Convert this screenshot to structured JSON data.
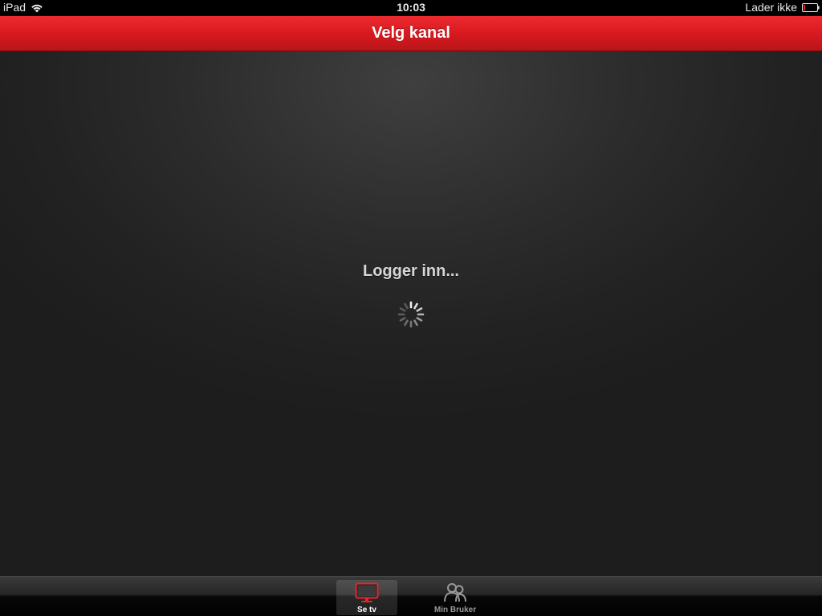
{
  "status_bar": {
    "device": "iPad",
    "time": "10:03",
    "battery_text": "Lader ikke"
  },
  "nav_bar": {
    "title": "Velg kanal"
  },
  "main": {
    "loading_label": "Logger inn...",
    "spinner_icon": "activity-spinner-icon"
  },
  "tab_bar": {
    "tabs": [
      {
        "label": "Se tv",
        "icon": "tv-icon",
        "selected": true
      },
      {
        "label": "Min Bruker",
        "icon": "users-icon",
        "selected": false
      }
    ]
  },
  "colors": {
    "nav_red": "#d81a20",
    "selected_tab_icon": "#e3262c",
    "unselected_tab_icon": "#9a9a9a"
  }
}
